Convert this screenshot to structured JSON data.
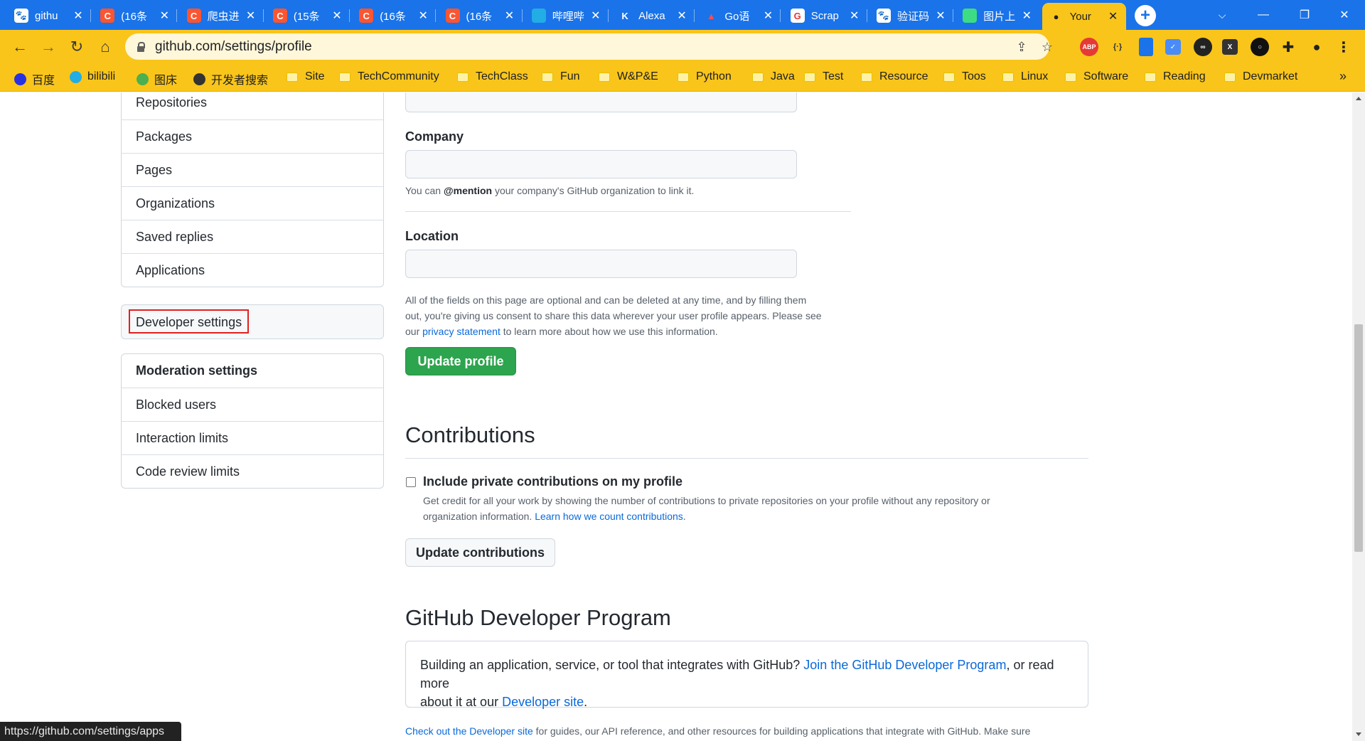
{
  "browser": {
    "tabs": [
      {
        "title": "githu",
        "fav": "baidu-paw",
        "favColor": "#ffffff",
        "favText": "🐾",
        "favTextColor": "#2932e1"
      },
      {
        "title": "(16条",
        "fav": "csdn",
        "favColor": "#fc5531",
        "favText": "C",
        "favTextColor": "#ffffff"
      },
      {
        "title": "爬虫进",
        "fav": "csdn",
        "favColor": "#fc5531",
        "favText": "C",
        "favTextColor": "#ffffff"
      },
      {
        "title": "(15条",
        "fav": "csdn",
        "favColor": "#fc5531",
        "favText": "C",
        "favTextColor": "#ffffff"
      },
      {
        "title": "(16条",
        "fav": "csdn",
        "favColor": "#fc5531",
        "favText": "C",
        "favTextColor": "#ffffff"
      },
      {
        "title": "(16条",
        "fav": "csdn",
        "favColor": "#fc5531",
        "favText": "C",
        "favTextColor": "#ffffff"
      },
      {
        "title": "哔哩哔",
        "fav": "bilibili",
        "favColor": "#23ade5",
        "favText": "",
        "favTextColor": "#ffffff"
      },
      {
        "title": "Alexa",
        "fav": "alexa",
        "favColor": "#1a73e8",
        "favText": "K",
        "favTextColor": "#ffffff"
      },
      {
        "title": "Go语",
        "fav": "go",
        "favColor": "#1a73e8",
        "favText": "▲",
        "favTextColor": "#ff4d4d"
      },
      {
        "title": "Scrap",
        "fav": "scrapy",
        "favColor": "#ffffff",
        "favText": "G",
        "favTextColor": "#e53935"
      },
      {
        "title": "验证码",
        "fav": "baidu-paw",
        "favColor": "#ffffff",
        "favText": "🐾",
        "favTextColor": "#2932e1"
      },
      {
        "title": "图片上",
        "fav": "globe",
        "favColor": "#3ddc84",
        "favText": "",
        "favTextColor": "#ffffff"
      },
      {
        "title": "Your",
        "fav": "github",
        "favColor": "#f9c51a",
        "favText": "●",
        "favTextColor": "#1f1f1f",
        "active": true
      }
    ],
    "url": "github.com/settings/profile",
    "bookmarks": [
      {
        "label": "百度",
        "icon": "baidu"
      },
      {
        "label": "bilibili",
        "icon": "bilibili"
      },
      {
        "label": "图床",
        "icon": "image"
      },
      {
        "label": "开发者搜索",
        "icon": "search"
      },
      {
        "label": "Site",
        "icon": "folder"
      },
      {
        "label": "TechCommunity",
        "icon": "folder"
      },
      {
        "label": "TechClass",
        "icon": "folder"
      },
      {
        "label": "Fun",
        "icon": "folder"
      },
      {
        "label": "W&P&E",
        "icon": "folder"
      },
      {
        "label": "Python",
        "icon": "folder"
      },
      {
        "label": "Java",
        "icon": "folder"
      },
      {
        "label": "Test",
        "icon": "folder"
      },
      {
        "label": "Resource",
        "icon": "folder"
      },
      {
        "label": "Toos",
        "icon": "folder"
      },
      {
        "label": "Linux",
        "icon": "folder"
      },
      {
        "label": "Software",
        "icon": "folder"
      },
      {
        "label": "Reading",
        "icon": "folder"
      },
      {
        "label": "Devmarket",
        "icon": "folder"
      }
    ],
    "status_url": "https://github.com/settings/apps",
    "colors": {
      "tabstrip": "#1a73e8",
      "toolbar": "#f9c51a"
    }
  },
  "sidebar": {
    "menu1": [
      "Repositories",
      "Packages",
      "Pages",
      "Organizations",
      "Saved replies",
      "Applications"
    ],
    "developer_settings": "Developer settings",
    "moderation": {
      "heading": "Moderation settings",
      "items": [
        "Blocked users",
        "Interaction limits",
        "Code review limits"
      ]
    }
  },
  "profile": {
    "company_label": "Company",
    "company_note": {
      "pre": "You can ",
      "mention": "@mention",
      "post": " your company's GitHub organization to link it."
    },
    "location_label": "Location",
    "optional_note": {
      "line1": "All of the fields on this page are optional and can be deleted at any time, and by filling them",
      "line2": "out, you're giving us consent to share this data wherever your user profile appears. Please see",
      "pre": "our ",
      "link": "privacy statement",
      "post": " to learn more about how we use this information."
    },
    "update_button": "Update profile"
  },
  "contributions": {
    "title": "Contributions",
    "checkbox_label": "Include private contributions on my profile",
    "checked": false,
    "desc_line1": "Get credit for all your work by showing the number of contributions to private repositories on your profile without any repository or",
    "desc_pre": "organization information. ",
    "desc_link": "Learn how we count contributions",
    "desc_post": ".",
    "button": "Update contributions"
  },
  "developer_program": {
    "title": "GitHub Developer Program",
    "text_pre": "Building an application, service, or tool that integrates with GitHub? ",
    "link1": "Join the GitHub Developer Program",
    "text_mid": ", or read more",
    "text_line2_pre": "about it at our ",
    "link2": "Developer site",
    "text_line2_post": ".",
    "footer_link": "Check out the Developer site",
    "footer_text": " for guides, our API reference, and other resources for building applications that integrate with GitHub. Make sure"
  }
}
